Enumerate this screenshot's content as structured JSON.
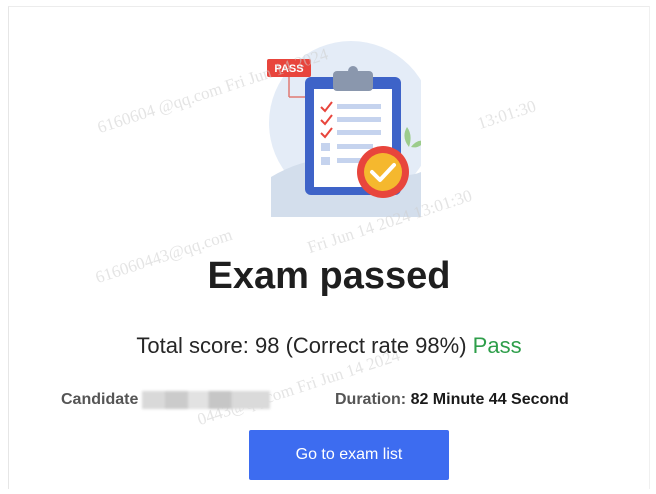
{
  "illustration": {
    "badge_text": "PASS"
  },
  "result": {
    "title": "Exam passed",
    "score_text": "Total score: 98 (Correct rate 98%)",
    "status": "Pass"
  },
  "candidate": {
    "label": "Candidate"
  },
  "duration": {
    "label": "Duration:",
    "value": "82 Minute 44 Second"
  },
  "actions": {
    "go_to_exam_list": "Go to exam list"
  },
  "watermarks": [
    "6160604 @qq.com Fri Jun 14 2024",
    "13:01:30",
    "616060443@qq.com",
    "Fri Jun 14 2024 13:01:30",
    "0443@qq.com Fri Jun 14 2024"
  ],
  "colors": {
    "primary": "#3d6cf0",
    "pass": "#2e9e4a",
    "badge": "#e8453c"
  }
}
